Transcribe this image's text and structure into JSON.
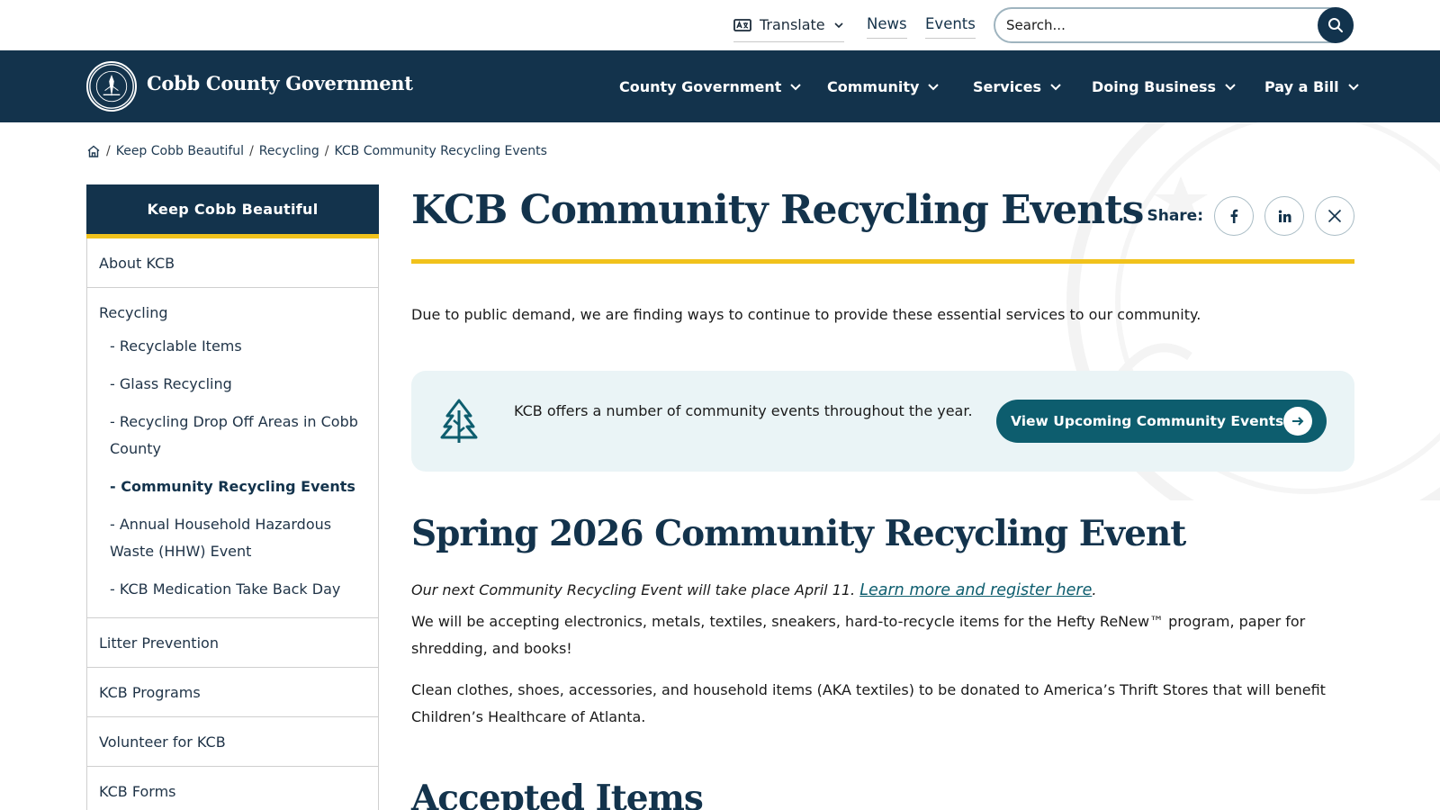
{
  "utility": {
    "translate_label": "Translate",
    "links": [
      "News",
      "Events"
    ],
    "search_placeholder": "Search..."
  },
  "header": {
    "site_title": "Cobb County Government",
    "nav": [
      "County Government",
      "Community",
      "Services",
      "Doing Business",
      "Pay a Bill"
    ]
  },
  "breadcrumb": {
    "items": [
      "Keep Cobb Beautiful",
      "Recycling",
      "KCB Community Recycling Events"
    ],
    "separator": "/"
  },
  "sidebar": {
    "heading": "Keep Cobb Beautiful",
    "items": [
      {
        "label": "About KCB"
      },
      {
        "label": "Recycling",
        "children": [
          "- Recyclable Items",
          "- Glass Recycling",
          "- Recycling Drop Off Areas in Cobb County",
          "- Community Recycling Events",
          "- Annual Household Hazardous Waste (HHW) Event",
          "- KCB Medication Take Back Day"
        ],
        "active_child_index": 3
      },
      {
        "label": "Litter Prevention"
      },
      {
        "label": "KCB Programs"
      },
      {
        "label": "Volunteer for KCB"
      },
      {
        "label": "KCB Forms"
      }
    ]
  },
  "main": {
    "title": "KCB Community Recycling Events",
    "share_label": "Share:",
    "intro": "Due to public demand, we are finding ways to continue to provide these essential services to our community.",
    "callout": {
      "text": "KCB offers a number of community events throughout the year.",
      "button_label": "View Upcoming Community Events"
    },
    "section_title": "Spring 2026 Community Recycling Event",
    "italic_text": "Our next Community Recycling Event will take place April 11.",
    "italic_link": "Learn more and register here",
    "italic_suffix": ".",
    "paragraph_1": "We will be accepting electronics, metals, textiles, sneakers, hard-to-recycle items for the Hefty ReNew™ program, paper for shredding, and books!",
    "paragraph_2": "Clean clothes, shoes, accessories, and household items (AKA textiles) to be donated to America’s Thrift Stores that will benefit Children’s Healthcare of Atlanta.",
    "next_heading": "Accepted Items"
  },
  "colors": {
    "navy": "#13334c",
    "gold": "#f1c21b",
    "teal": "#0d5d6e",
    "callout_bg": "#eaf4f6"
  },
  "icons": [
    "translate-icon",
    "chevron-down-icon",
    "search-icon",
    "seal-logo",
    "home-icon",
    "facebook-icon",
    "linkedin-icon",
    "x-icon",
    "tree-icon",
    "arrow-right-icon"
  ]
}
